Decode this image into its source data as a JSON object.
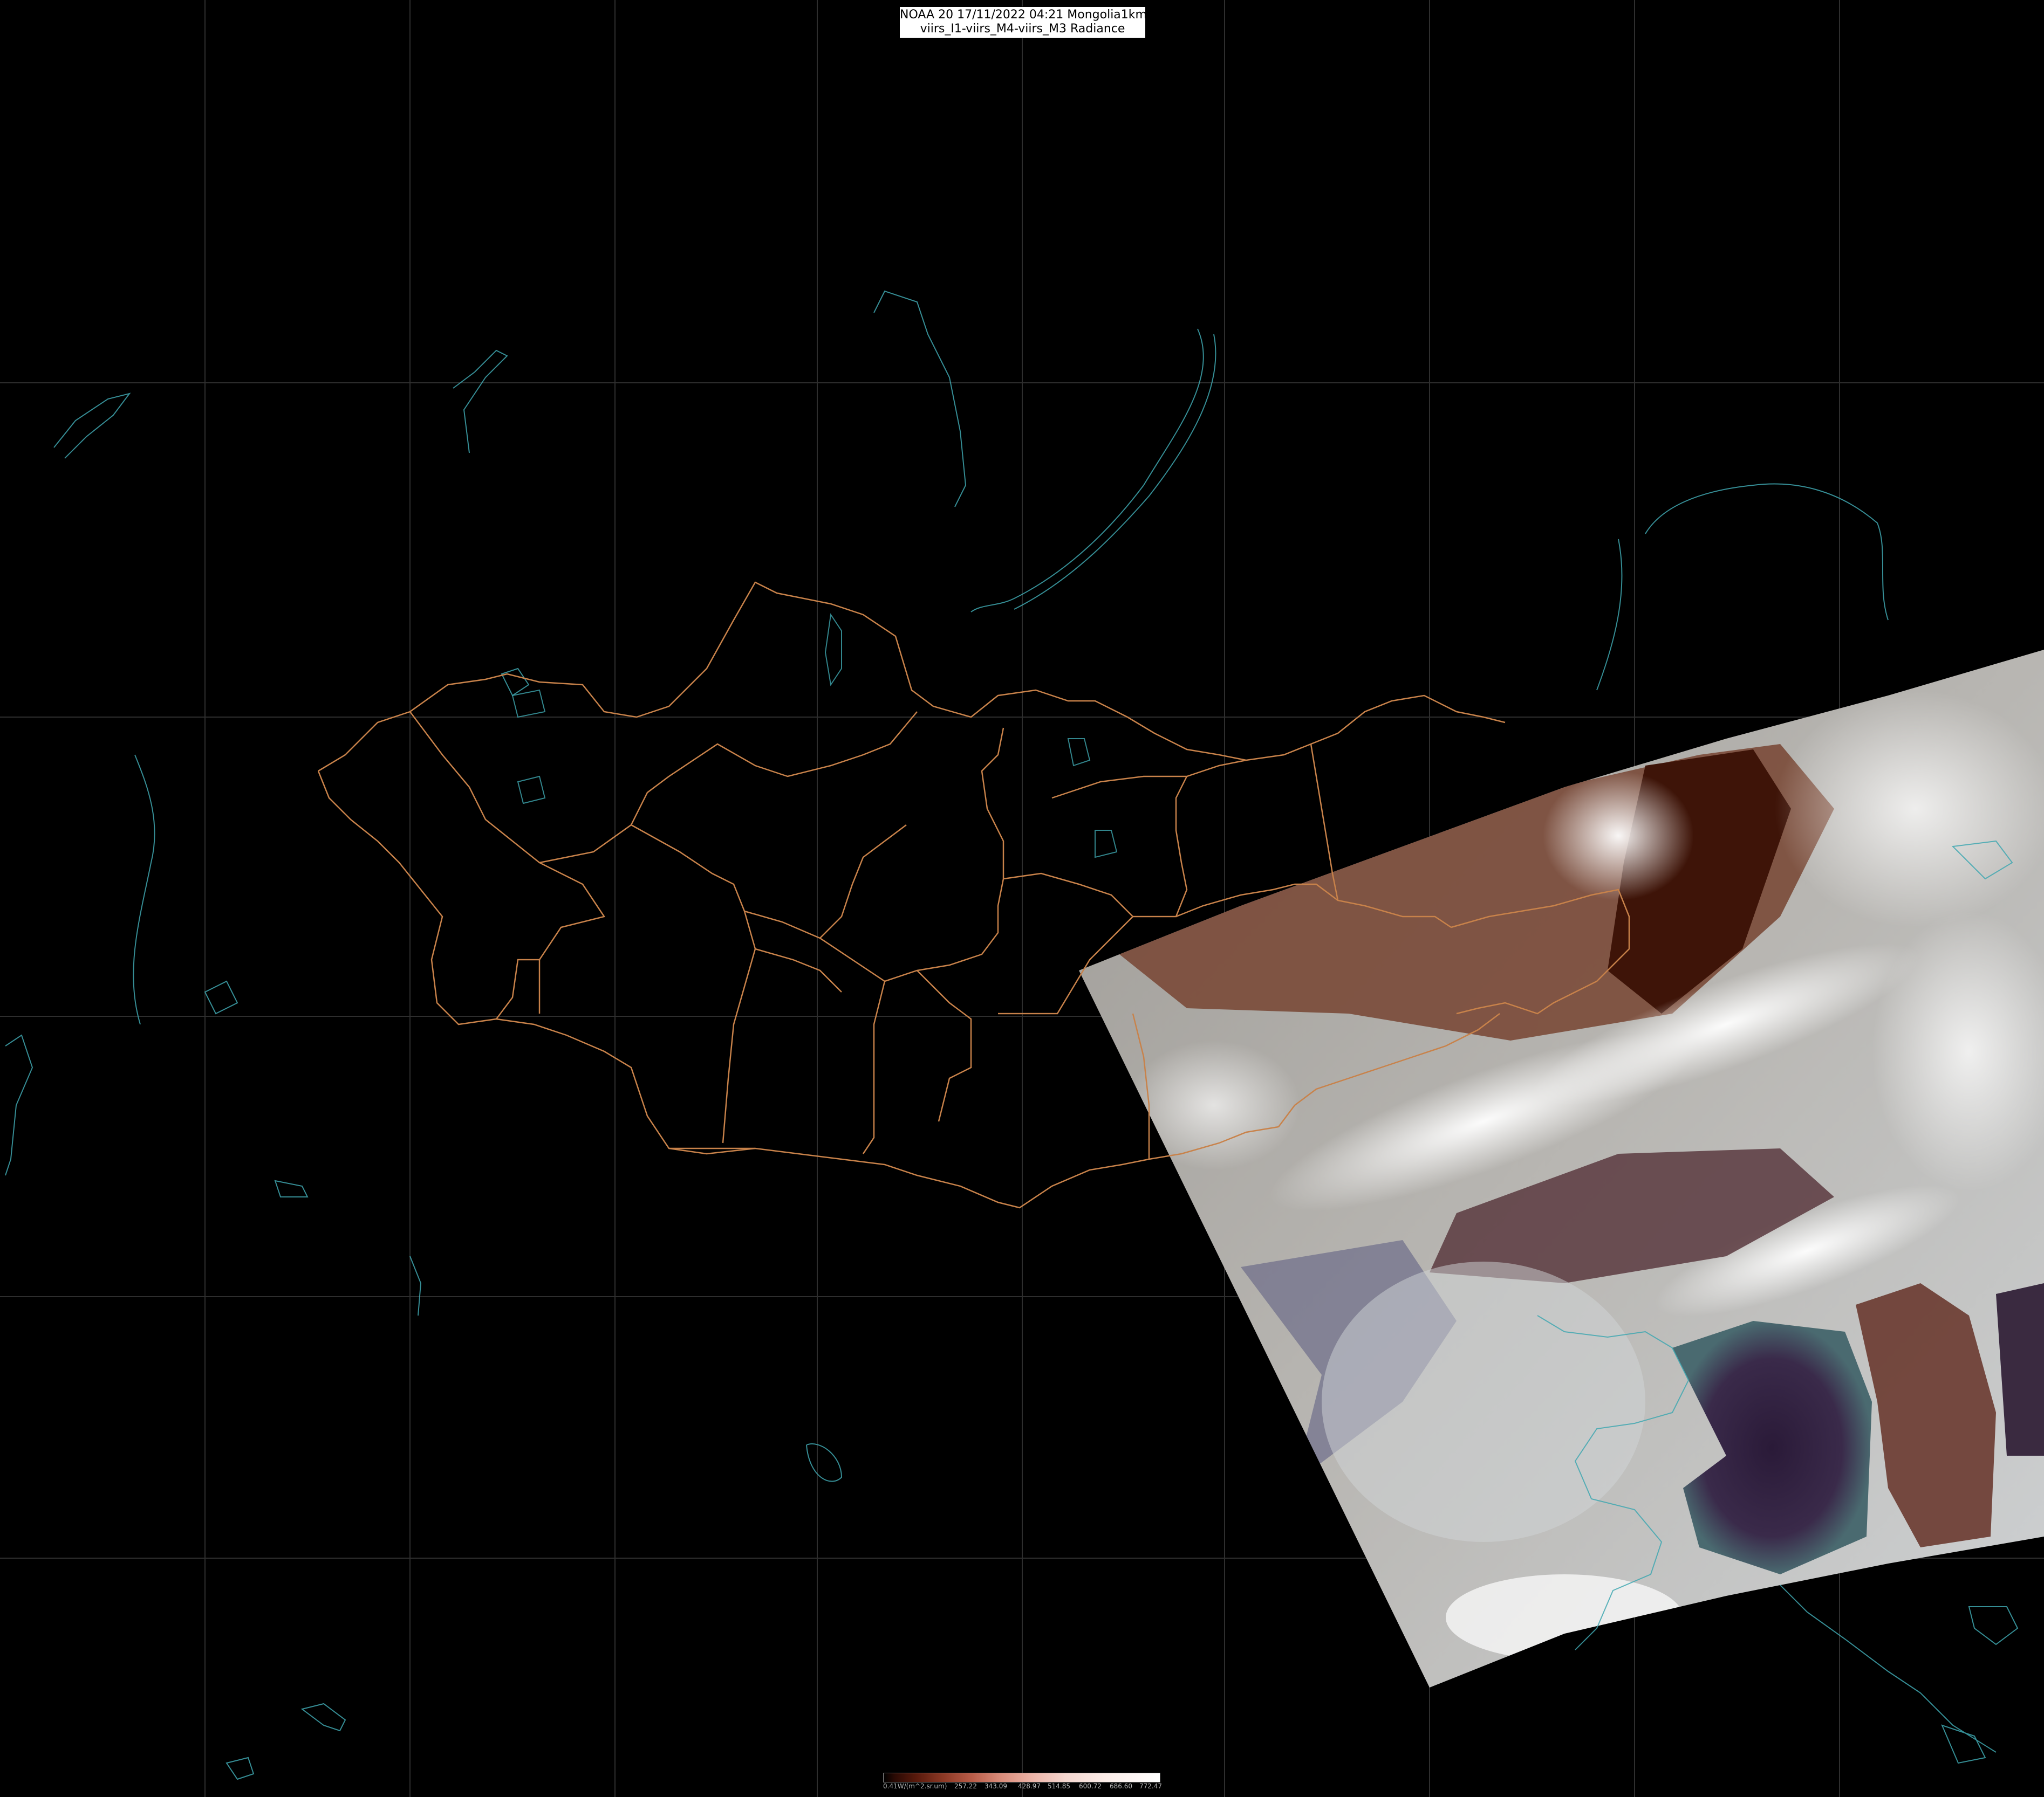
{
  "map": {
    "title_line1": "NOAA 20 17/11/2022 04:21 Mongolia1km",
    "title_line2": "viirs_I1-viirs_M4-viirs_M3 Radiance",
    "colors": {
      "background": "#000000",
      "graticule": "#2e2e2e",
      "coastline": "#3fa7b0",
      "admin_border": "#c8824a"
    },
    "legend": {
      "ticks": [
        "0.41W/(m^2.sr.um)",
        "257.22",
        "343.09",
        "428.97",
        "514.85",
        "600.72",
        "686.60",
        "772.47"
      ]
    }
  }
}
